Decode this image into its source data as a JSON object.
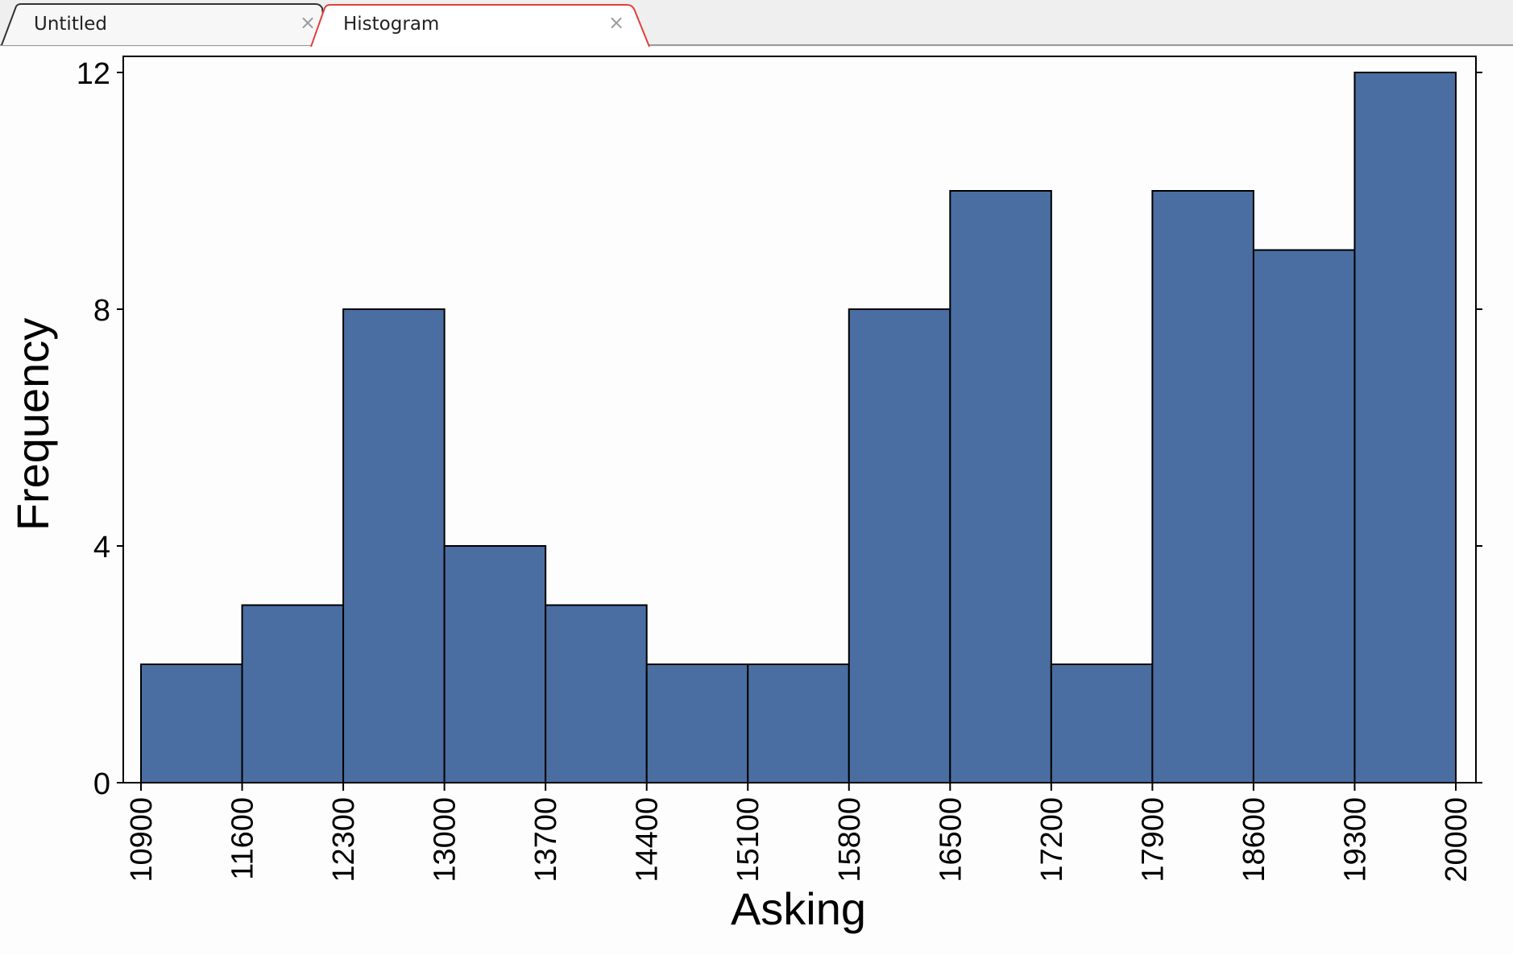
{
  "tabs": [
    {
      "label": "Untitled",
      "close": "×",
      "active": false
    },
    {
      "label": "Histogram",
      "close": "×",
      "active": true
    }
  ],
  "colors": {
    "bar_fill": "#4a6ea2",
    "bar_stroke": "#000000",
    "active_tab_border": "#e0403c",
    "tab_border": "#333333"
  },
  "chart_data": {
    "type": "bar",
    "title": "",
    "xlabel": "Asking",
    "ylabel": "Frequency",
    "bin_edges": [
      10900,
      11600,
      12300,
      13000,
      13700,
      14400,
      15100,
      15800,
      16500,
      17200,
      17900,
      18600,
      19300,
      20000
    ],
    "values": [
      2,
      3,
      8,
      4,
      3,
      2,
      2,
      8,
      10,
      2,
      10,
      9,
      12
    ],
    "x_tick_labels": [
      "10900",
      "11600",
      "12300",
      "13000",
      "13700",
      "14400",
      "15100",
      "15800",
      "16500",
      "17200",
      "17900",
      "18600",
      "19300",
      "20000"
    ],
    "y_ticks": [
      0,
      4,
      8,
      12
    ],
    "y_tick_labels": [
      "0",
      "4",
      "8",
      "12"
    ],
    "ylim": [
      0,
      12
    ],
    "xlim": [
      10900,
      20000
    ],
    "grid": false,
    "legend": "none"
  }
}
